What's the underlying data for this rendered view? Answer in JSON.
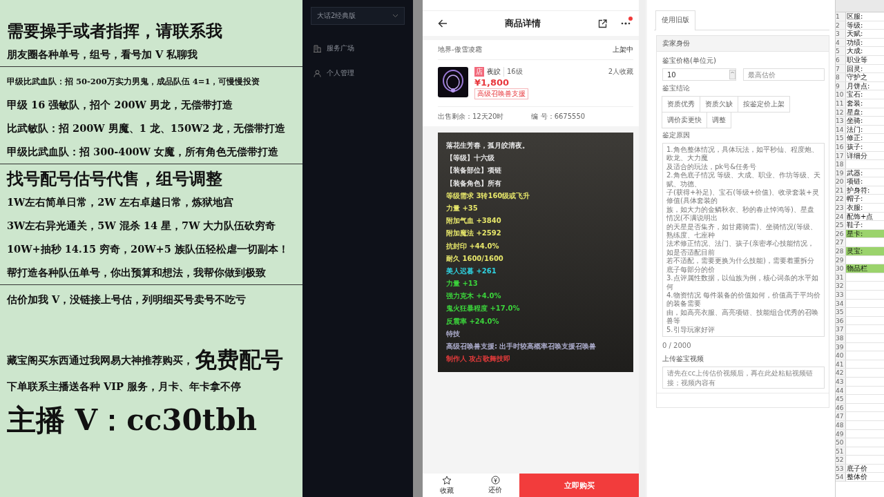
{
  "promo_panel": {
    "lines": [
      {
        "kind": "title",
        "text": "需要操手或者指挥，请联系我",
        "rule_below": false
      },
      {
        "kind": "line",
        "text": "朋友圈各种单号，组号，看号加 V 私聊我",
        "rule_below": true
      },
      {
        "kind": "small",
        "text": "甲级比武血队：招 50-200万实力男鬼，成品队伍 4=1，可慢慢投资",
        "rule_below": false
      },
      {
        "kind": "line",
        "text": "甲级 16 强敏队，招个 200W 男龙，无偿带打造",
        "rule_below": false
      },
      {
        "kind": "line",
        "text": "比武敏队：招 200W 男魔、1 龙、150W2 龙，无偿带打造",
        "rule_below": false
      },
      {
        "kind": "line",
        "text": "甲级比武血队：招 300-400W 女魔，所有角色无偿带打造",
        "rule_below": true
      },
      {
        "kind": "title",
        "text": "找号配号估号代售，组号调整",
        "rule_below": false
      },
      {
        "kind": "line",
        "text": "1W左右简单日常，2W 左右卓越日常，炼狱地宫",
        "rule_below": false
      },
      {
        "kind": "line",
        "text": "3W左右异光通关，5W 混杀 14 星，7W 大力队伍砍穷奇",
        "rule_below": false
      },
      {
        "kind": "line",
        "text": "10W+抽秒 14.15 穷奇，20W+5 族队伍轻松虐一切副本！",
        "rule_below": false
      },
      {
        "kind": "line",
        "text": "帮打造各种队伍单号，你出预算和想法，我帮你做到极致",
        "rule_below": true
      },
      {
        "kind": "line",
        "text": "估价加我 V，没链接上号估，列明细买号卖号不吃亏",
        "rule_below": false
      },
      {
        "kind": "mixed",
        "text": "藏宝阁买东西通过我网易大神推荐购买，",
        "emphasis": "免费配号",
        "rule_below": false
      },
      {
        "kind": "line",
        "text": "下单联系主播送各种 VIP 服务，月卡、年卡拿不停",
        "rule_below": false
      },
      {
        "kind": "huge",
        "text": "主播 V：cc30tbh",
        "rule_below": false
      }
    ]
  },
  "sidebar": {
    "dropdown": "大话2经典版",
    "items": [
      {
        "label": "服务广场",
        "selected": false
      },
      {
        "label": "个人管理",
        "selected": false
      }
    ]
  },
  "product": {
    "title": "商品详情",
    "notification_dot": true,
    "server": "地界-傲雪凌霜",
    "status": "上架中",
    "shop_badge": "店",
    "name": "夜皎",
    "level": "16级",
    "price": "¥1,800",
    "tag": "高级召唤兽支援",
    "favorites": "2人收藏",
    "time_left": "出售剩余：12天20时",
    "serial": "编 号：6675550",
    "description": [
      {
        "text": "落花生芳春，孤月皎清夜。",
        "color": "#e6e6e6"
      },
      {
        "text": "【等级】十六级",
        "color": "#e6e6e6"
      },
      {
        "text": "【装备部位】项链",
        "color": "#e6e6e6"
      },
      {
        "text": "【装备角色】所有",
        "color": "#e6e6e6"
      },
      {
        "text": "等级需求 3转160级或飞升",
        "color": "#e6e66a"
      },
      {
        "text": "力量 +35",
        "color": "#e6e66a"
      },
      {
        "text": "附加气血 +3840",
        "color": "#e6e66a"
      },
      {
        "text": "附加魔法 +2592",
        "color": "#e6e66a"
      },
      {
        "text": "抗封印 +44.0%",
        "color": "#e6e66a"
      },
      {
        "text": "耐久 1600/1600",
        "color": "#e6e66a"
      },
      {
        "text": "美人迟暮 +261",
        "color": "#2fd2e0"
      },
      {
        "text": "力量 +13",
        "color": "#3bd23b"
      },
      {
        "text": "强力克木 +4.0%",
        "color": "#3bd23b"
      },
      {
        "text": "鬼火狂暴程度 +17.0%",
        "color": "#3bd23b"
      },
      {
        "text": "反震率 +24.0%",
        "color": "#3bd23b"
      },
      {
        "text": "特技",
        "color": "#a9a9c8"
      },
      {
        "text": "高级召唤兽支援: 出手时较高概率召唤支援召唤兽",
        "color": "#a9a9c8"
      },
      {
        "text": "制作人 攻占歌舞技即",
        "color": "#e03a3a"
      }
    ],
    "actions": [
      {
        "label": "收藏",
        "kind": "star"
      },
      {
        "label": "还价",
        "kind": "coin"
      }
    ],
    "buy_button": "立即购买"
  },
  "appraisal_form": {
    "tab": "使用旧版",
    "section": "卖家身份",
    "price_label": "鉴宝价格(单位元)",
    "price_value": "10",
    "max_placeholder": "最高估价",
    "conclusion_label": "鉴宝结论",
    "conclusions": [
      {
        "label": "资质优秀",
        "selected": false
      },
      {
        "label": "资质欠缺",
        "selected": false
      },
      {
        "label": "按鉴定价上架",
        "selected": false
      },
      {
        "label": "调价卖更快",
        "selected": false
      },
      {
        "label": "调整",
        "selected": false
      }
    ],
    "reason_label": "鉴定原因",
    "reason_lines": [
      "1.角色整体情况，具体玩法，如平秒仙、程度炮、欧龙、大力魔",
      "及适合的玩法，pk号&任务号",
      "2.角色底子情况 等级、大成、职业、作坊等级、天赋、功德、",
      "子(获得+补足)、宝石(等级+价值)、收录套装+灵修值(具体套装的",
      "族，如大力的金鳞秋衣、秒的春止悼鸿等)、星盘情况(不满说明出",
      "的天星是否集齐，如甘露骑雷)、坐骑情况(等级、熟练度、七座种",
      "法术修正情况、法门、孩子(亲密孝心技能情况，如是否适配目前",
      "若不适配，需要更换为什么技能)，需要着重拆分底子每部分的价",
      "3.点评属性数据，以仙族为例，核心词条的水平如何",
      "4.物资情况 每件装备的价值如何，价值高于平均价的装备需要",
      "由，如高亮衣服、高亮项链、技能组合优秀的召唤兽等",
      "5.引导玩家好评"
    ],
    "counter": "0 / 2000",
    "video_label": "上传鉴宝视频",
    "video_placeholder": "请先在cc上传估价视频后，再在此处粘贴视频链接；视频内容有"
  },
  "spreadsheet": {
    "rows": [
      {
        "number": "1",
        "label": "区服:",
        "highlighted": false
      },
      {
        "number": "2",
        "label": "等级:",
        "highlighted": false
      },
      {
        "number": "3",
        "label": "天赋:",
        "highlighted": false
      },
      {
        "number": "4",
        "label": "功绩:",
        "highlighted": false
      },
      {
        "number": "5",
        "label": "大成:",
        "highlighted": false
      },
      {
        "number": "6",
        "label": "职业等",
        "highlighted": false
      },
      {
        "number": "7",
        "label": "回灵:",
        "highlighted": false
      },
      {
        "number": "8",
        "label": "守护之",
        "highlighted": false
      },
      {
        "number": "9",
        "label": "月饼点:",
        "highlighted": false
      },
      {
        "number": "10",
        "label": "宝石:",
        "highlighted": false
      },
      {
        "number": "11",
        "label": "套装:",
        "highlighted": false
      },
      {
        "number": "12",
        "label": "星盘:",
        "highlighted": false
      },
      {
        "number": "13",
        "label": "坐骑:",
        "highlighted": false
      },
      {
        "number": "14",
        "label": "法门:",
        "highlighted": false
      },
      {
        "number": "15",
        "label": "修正:",
        "highlighted": false
      },
      {
        "number": "16",
        "label": "孩子:",
        "highlighted": false
      },
      {
        "number": "17",
        "label": "详细分",
        "highlighted": false
      },
      {
        "number": "18",
        "highlighted": false
      },
      {
        "number": "19",
        "label": "武器:",
        "highlighted": false
      },
      {
        "number": "20",
        "label": "项链:",
        "highlighted": false
      },
      {
        "number": "21",
        "label": "护身符:",
        "highlighted": false
      },
      {
        "number": "22",
        "label": "帽子:",
        "highlighted": false
      },
      {
        "number": "23",
        "label": "衣服:",
        "highlighted": false
      },
      {
        "number": "24",
        "label": "配饰+点",
        "highlighted": false
      },
      {
        "number": "25",
        "label": "鞋子:",
        "highlighted": false
      },
      {
        "number": "26",
        "label": "星卡:",
        "highlighted": true
      },
      {
        "number": "27",
        "highlighted": false
      },
      {
        "number": "28",
        "label": "灵宝:",
        "highlighted": true
      },
      {
        "number": "29",
        "highlighted": false
      },
      {
        "number": "30",
        "label": "物品栏",
        "highlighted": true
      },
      {
        "number": "31",
        "highlighted": false
      },
      {
        "number": "32",
        "highlighted": false
      },
      {
        "number": "33",
        "highlighted": false
      },
      {
        "number": "34",
        "highlighted": false
      },
      {
        "number": "35",
        "highlighted": false
      },
      {
        "number": "36",
        "highlighted": false
      },
      {
        "number": "37",
        "highlighted": false
      },
      {
        "number": "38",
        "highlighted": false
      },
      {
        "number": "39",
        "highlighted": false
      },
      {
        "number": "40",
        "highlighted": false
      },
      {
        "number": "41",
        "highlighted": false
      },
      {
        "number": "42",
        "highlighted": false
      },
      {
        "number": "43",
        "highlighted": false
      },
      {
        "number": "44",
        "highlighted": false
      },
      {
        "number": "45",
        "highlighted": false
      },
      {
        "number": "46",
        "highlighted": false
      },
      {
        "number": "47",
        "highlighted": false
      },
      {
        "number": "48",
        "highlighted": false
      },
      {
        "number": "49",
        "highlighted": false
      },
      {
        "number": "50",
        "highlighted": false
      },
      {
        "number": "51",
        "highlighted": false
      },
      {
        "number": "52",
        "highlighted": false
      },
      {
        "number": "53",
        "label": "底子价",
        "highlighted": false
      },
      {
        "number": "54",
        "label": "整体价",
        "highlighted": false
      }
    ]
  }
}
